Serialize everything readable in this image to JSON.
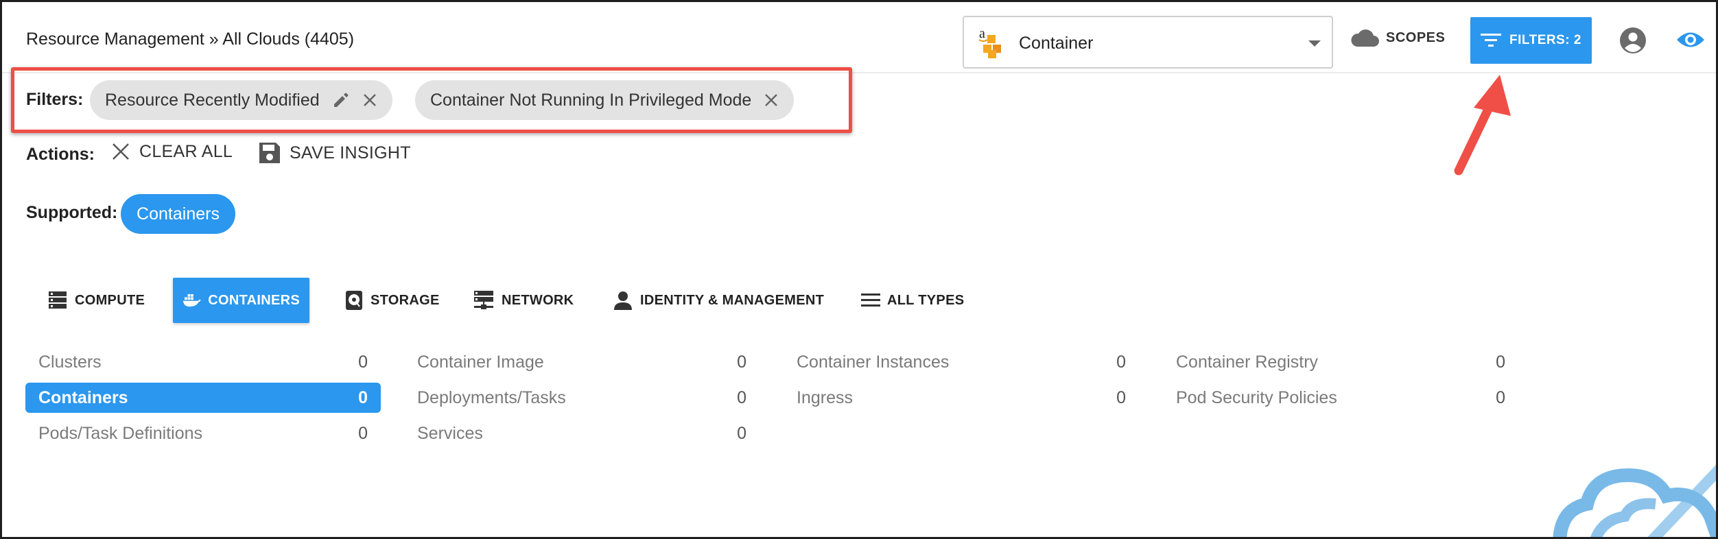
{
  "header": {
    "breadcrumb": "Resource Management » All Clouds (4405)",
    "cloud_selector": {
      "value": "Container",
      "icon": "aws-logo-icon"
    },
    "scopes_label": "SCOPES",
    "filters_button_label": "FILTERS: 2"
  },
  "filters": {
    "label": "Filters:",
    "chips": [
      {
        "label": "Resource Recently Modified",
        "editable": true
      },
      {
        "label": "Container Not Running In Privileged Mode",
        "editable": false
      }
    ]
  },
  "actions": {
    "label": "Actions:",
    "clear_all": "CLEAR ALL",
    "save_insight": "SAVE INSIGHT"
  },
  "supported": {
    "label": "Supported:",
    "value": "Containers"
  },
  "tabs": [
    {
      "label": "COMPUTE",
      "icon": "server-icon",
      "active": false
    },
    {
      "label": "CONTAINERS",
      "icon": "docker-icon",
      "active": true
    },
    {
      "label": "STORAGE",
      "icon": "storage-icon",
      "active": false
    },
    {
      "label": "NETWORK",
      "icon": "network-icon",
      "active": false
    },
    {
      "label": "IDENTITY & MANAGEMENT",
      "icon": "person-icon",
      "active": false
    },
    {
      "label": "ALL TYPES",
      "icon": "list-icon",
      "active": false
    }
  ],
  "resources": [
    {
      "label": "Clusters",
      "count": "0"
    },
    {
      "label": "Containers",
      "count": "0",
      "selected": true
    },
    {
      "label": "Pods/Task Definitions",
      "count": "0"
    },
    {
      "label": "Container Image",
      "count": "0"
    },
    {
      "label": "Deployments/Tasks",
      "count": "0"
    },
    {
      "label": "Services",
      "count": "0"
    },
    {
      "label": "Container Instances",
      "count": "0"
    },
    {
      "label": "Ingress",
      "count": "0"
    },
    {
      "label": "Container Registry",
      "count": "0"
    },
    {
      "label": "Pod Security Policies",
      "count": "0"
    }
  ],
  "colors": {
    "accent": "#2b97ee",
    "highlight_border": "#ef4f47",
    "chip_bg": "#e3e3e3"
  }
}
